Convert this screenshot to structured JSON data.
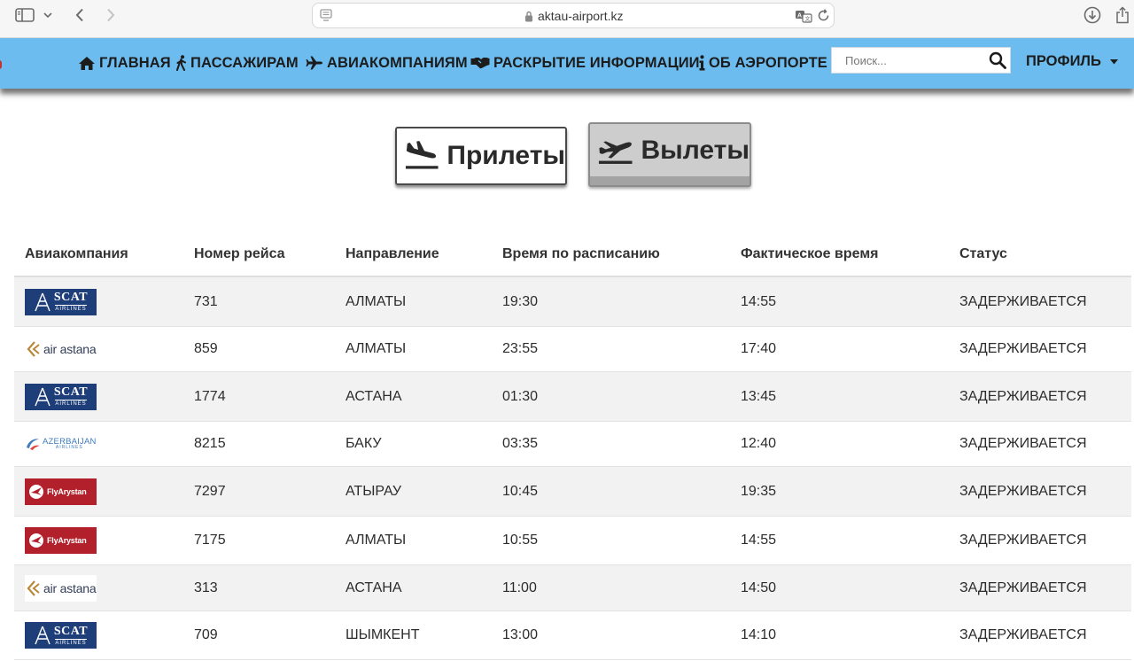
{
  "browser": {
    "url": "aktau-airport.kz",
    "icons": [
      "sidebar-icon",
      "chevron-down-icon",
      "back-arrow-icon",
      "forward-arrow-icon",
      "page-icon",
      "lock-icon",
      "translate-icon",
      "reload-icon",
      "download-icon",
      "share-icon"
    ]
  },
  "nav": {
    "items": [
      {
        "label": "ГЛАВНАЯ",
        "icon": "home-icon"
      },
      {
        "label": "ПАССАЖИРАМ",
        "icon": "walking-person-icon"
      },
      {
        "label": "АВИАКОМПАНИЯМ",
        "icon": "airplane-icon"
      },
      {
        "label": "РАСКРЫТИЕ ИНФОРМАЦИИ",
        "icon": "handshake-icon"
      },
      {
        "label": "ОБ АЭРОПОРТЕ",
        "icon": "info-icon"
      }
    ],
    "search_placeholder": "Поиск...",
    "profile_label": "ПРОФИЛЬ",
    "colors": {
      "bar": "#6dbcef"
    }
  },
  "board": {
    "arrivals_label": "Прилеты",
    "departures_label": "Вылеты",
    "active": "departures"
  },
  "table": {
    "headers": [
      "Авиакомпания",
      "Номер рейса",
      "Направление",
      "Время по расписанию",
      "Фактическое время",
      "Статус"
    ],
    "rows": [
      {
        "airline_logo": "scat",
        "airline_text": "SCAT",
        "airline_sub": "AIRLINES",
        "flight": "731",
        "destination": "АЛМАТЫ",
        "scheduled": "19:30",
        "actual": "14:55",
        "status": "ЗАДЕРЖИВАЕТСЯ"
      },
      {
        "airline_logo": "astana",
        "airline_text": "air astana",
        "airline_sub": "",
        "flight": "859",
        "destination": "АЛМАТЫ",
        "scheduled": "23:55",
        "actual": "17:40",
        "status": "ЗАДЕРЖИВАЕТСЯ"
      },
      {
        "airline_logo": "scat",
        "airline_text": "SCAT",
        "airline_sub": "AIRLINES",
        "flight": "1774",
        "destination": "АСТАНА",
        "scheduled": "01:30",
        "actual": "13:45",
        "status": "ЗАДЕРЖИВАЕТСЯ"
      },
      {
        "airline_logo": "azal",
        "airline_text": "AZERBAIJAN",
        "airline_sub": "AIRLINES",
        "flight": "8215",
        "destination": "БАКУ",
        "scheduled": "03:35",
        "actual": "12:40",
        "status": "ЗАДЕРЖИВАЕТСЯ"
      },
      {
        "airline_logo": "fly",
        "airline_text": "FlyArystan",
        "airline_sub": "",
        "flight": "7297",
        "destination": "АТЫРАУ",
        "scheduled": "10:45",
        "actual": "19:35",
        "status": "ЗАДЕРЖИВАЕТСЯ"
      },
      {
        "airline_logo": "fly",
        "airline_text": "FlyArystan",
        "airline_sub": "",
        "flight": "7175",
        "destination": "АЛМАТЫ",
        "scheduled": "10:55",
        "actual": "14:55",
        "status": "ЗАДЕРЖИВАЕТСЯ"
      },
      {
        "airline_logo": "astana",
        "airline_text": "air astana",
        "airline_sub": "",
        "flight": "313",
        "destination": "АСТАНА",
        "scheduled": "11:00",
        "actual": "14:50",
        "status": "ЗАДЕРЖИВАЕТСЯ"
      },
      {
        "airline_logo": "scat",
        "airline_text": "SCAT",
        "airline_sub": "AIRLINES",
        "flight": "709",
        "destination": "ШЫМКЕНТ",
        "scheduled": "13:00",
        "actual": "14:10",
        "status": "ЗАДЕРЖИВАЕТСЯ"
      }
    ]
  }
}
